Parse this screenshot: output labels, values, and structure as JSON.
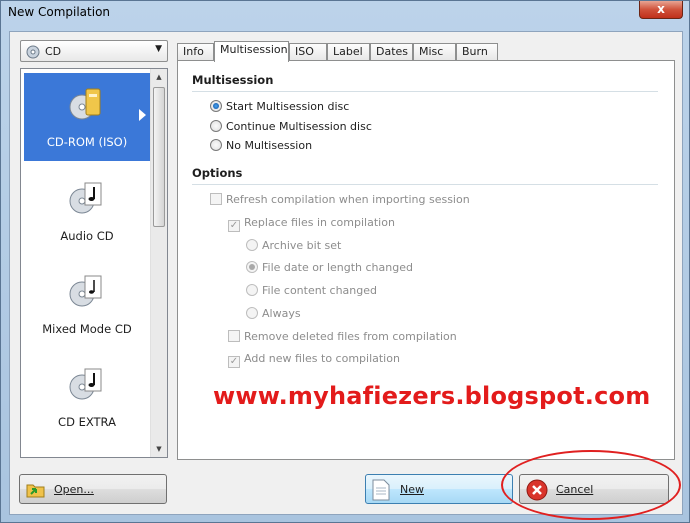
{
  "window": {
    "title": "New Compilation",
    "close_glyph": "x"
  },
  "media_select": {
    "value": "CD"
  },
  "media_list": [
    {
      "label": "CD-ROM (ISO)",
      "selected": true
    },
    {
      "label": "Audio CD",
      "selected": false
    },
    {
      "label": "Mixed Mode CD",
      "selected": false
    },
    {
      "label": "CD EXTRA",
      "selected": false
    }
  ],
  "tabs": [
    "Info",
    "Multisession",
    "ISO",
    "Label",
    "Dates",
    "Misc",
    "Burn"
  ],
  "active_tab": "Multisession",
  "multisession": {
    "title": "Multisession",
    "options": [
      "Start Multisession disc",
      "Continue Multisession disc",
      "No Multisession"
    ],
    "selected": "Start Multisession disc"
  },
  "options_section": {
    "title": "Options",
    "refresh": "Refresh compilation when importing session",
    "replace": "Replace files in compilation",
    "archive_bit": "Archive bit set",
    "file_date": "File date or length changed",
    "file_content": "File content changed",
    "always": "Always",
    "remove_deleted": "Remove deleted files from compilation",
    "add_new": "Add new files to compilation"
  },
  "watermark": "www.myhafiezers.blogspot.com",
  "buttons": {
    "open": "Open...",
    "new": "New",
    "cancel": "Cancel"
  },
  "colors": {
    "selection": "#3b78d8",
    "watermark": "#e31b1b",
    "highlight": "#e02020"
  }
}
